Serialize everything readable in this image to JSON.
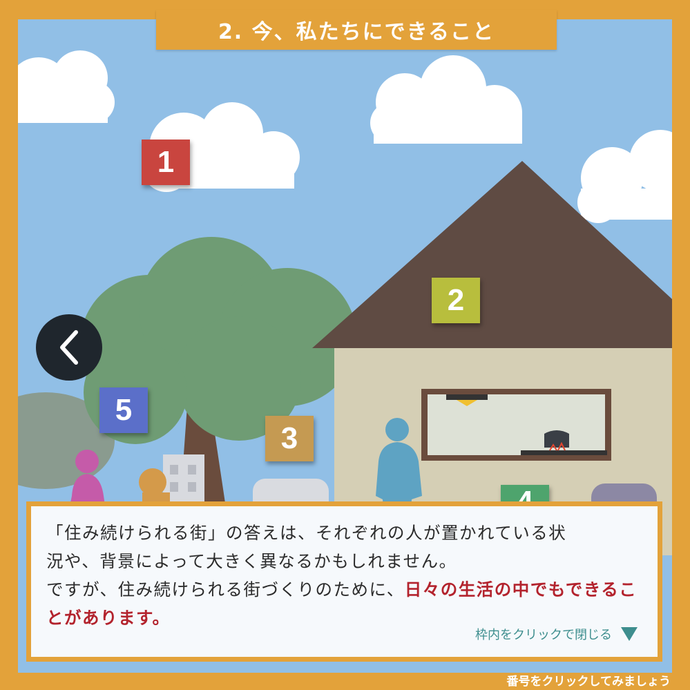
{
  "colors": {
    "bg": "#e3a23a",
    "sky": "#91bfe6",
    "highlight": "#b3232d",
    "marker_1": "#c9453f",
    "marker_2": "#b8be3d",
    "marker_3": "#c59a52",
    "marker_4": "#4ea46d",
    "marker_5": "#5b6fc9"
  },
  "title": "2. 今、私たちにできること",
  "markers": {
    "m1": "1",
    "m2": "2",
    "m3": "3",
    "m4": "4",
    "m5": "5"
  },
  "back_icon": "chevron-left-icon",
  "dialog": {
    "line1": "「住み続けられる街」の答えは、それぞれの人が置かれている状",
    "line2": "況や、背景によって大きく異なるかもしれません。",
    "line3_normal": "ですが、住み続けられる街づくりのために、",
    "highlight": "日々の生活の中でもできることがあります。",
    "close_hint": "枠内をクリックで閉じる"
  },
  "footer_hint": "番号をクリックしてみましょう"
}
